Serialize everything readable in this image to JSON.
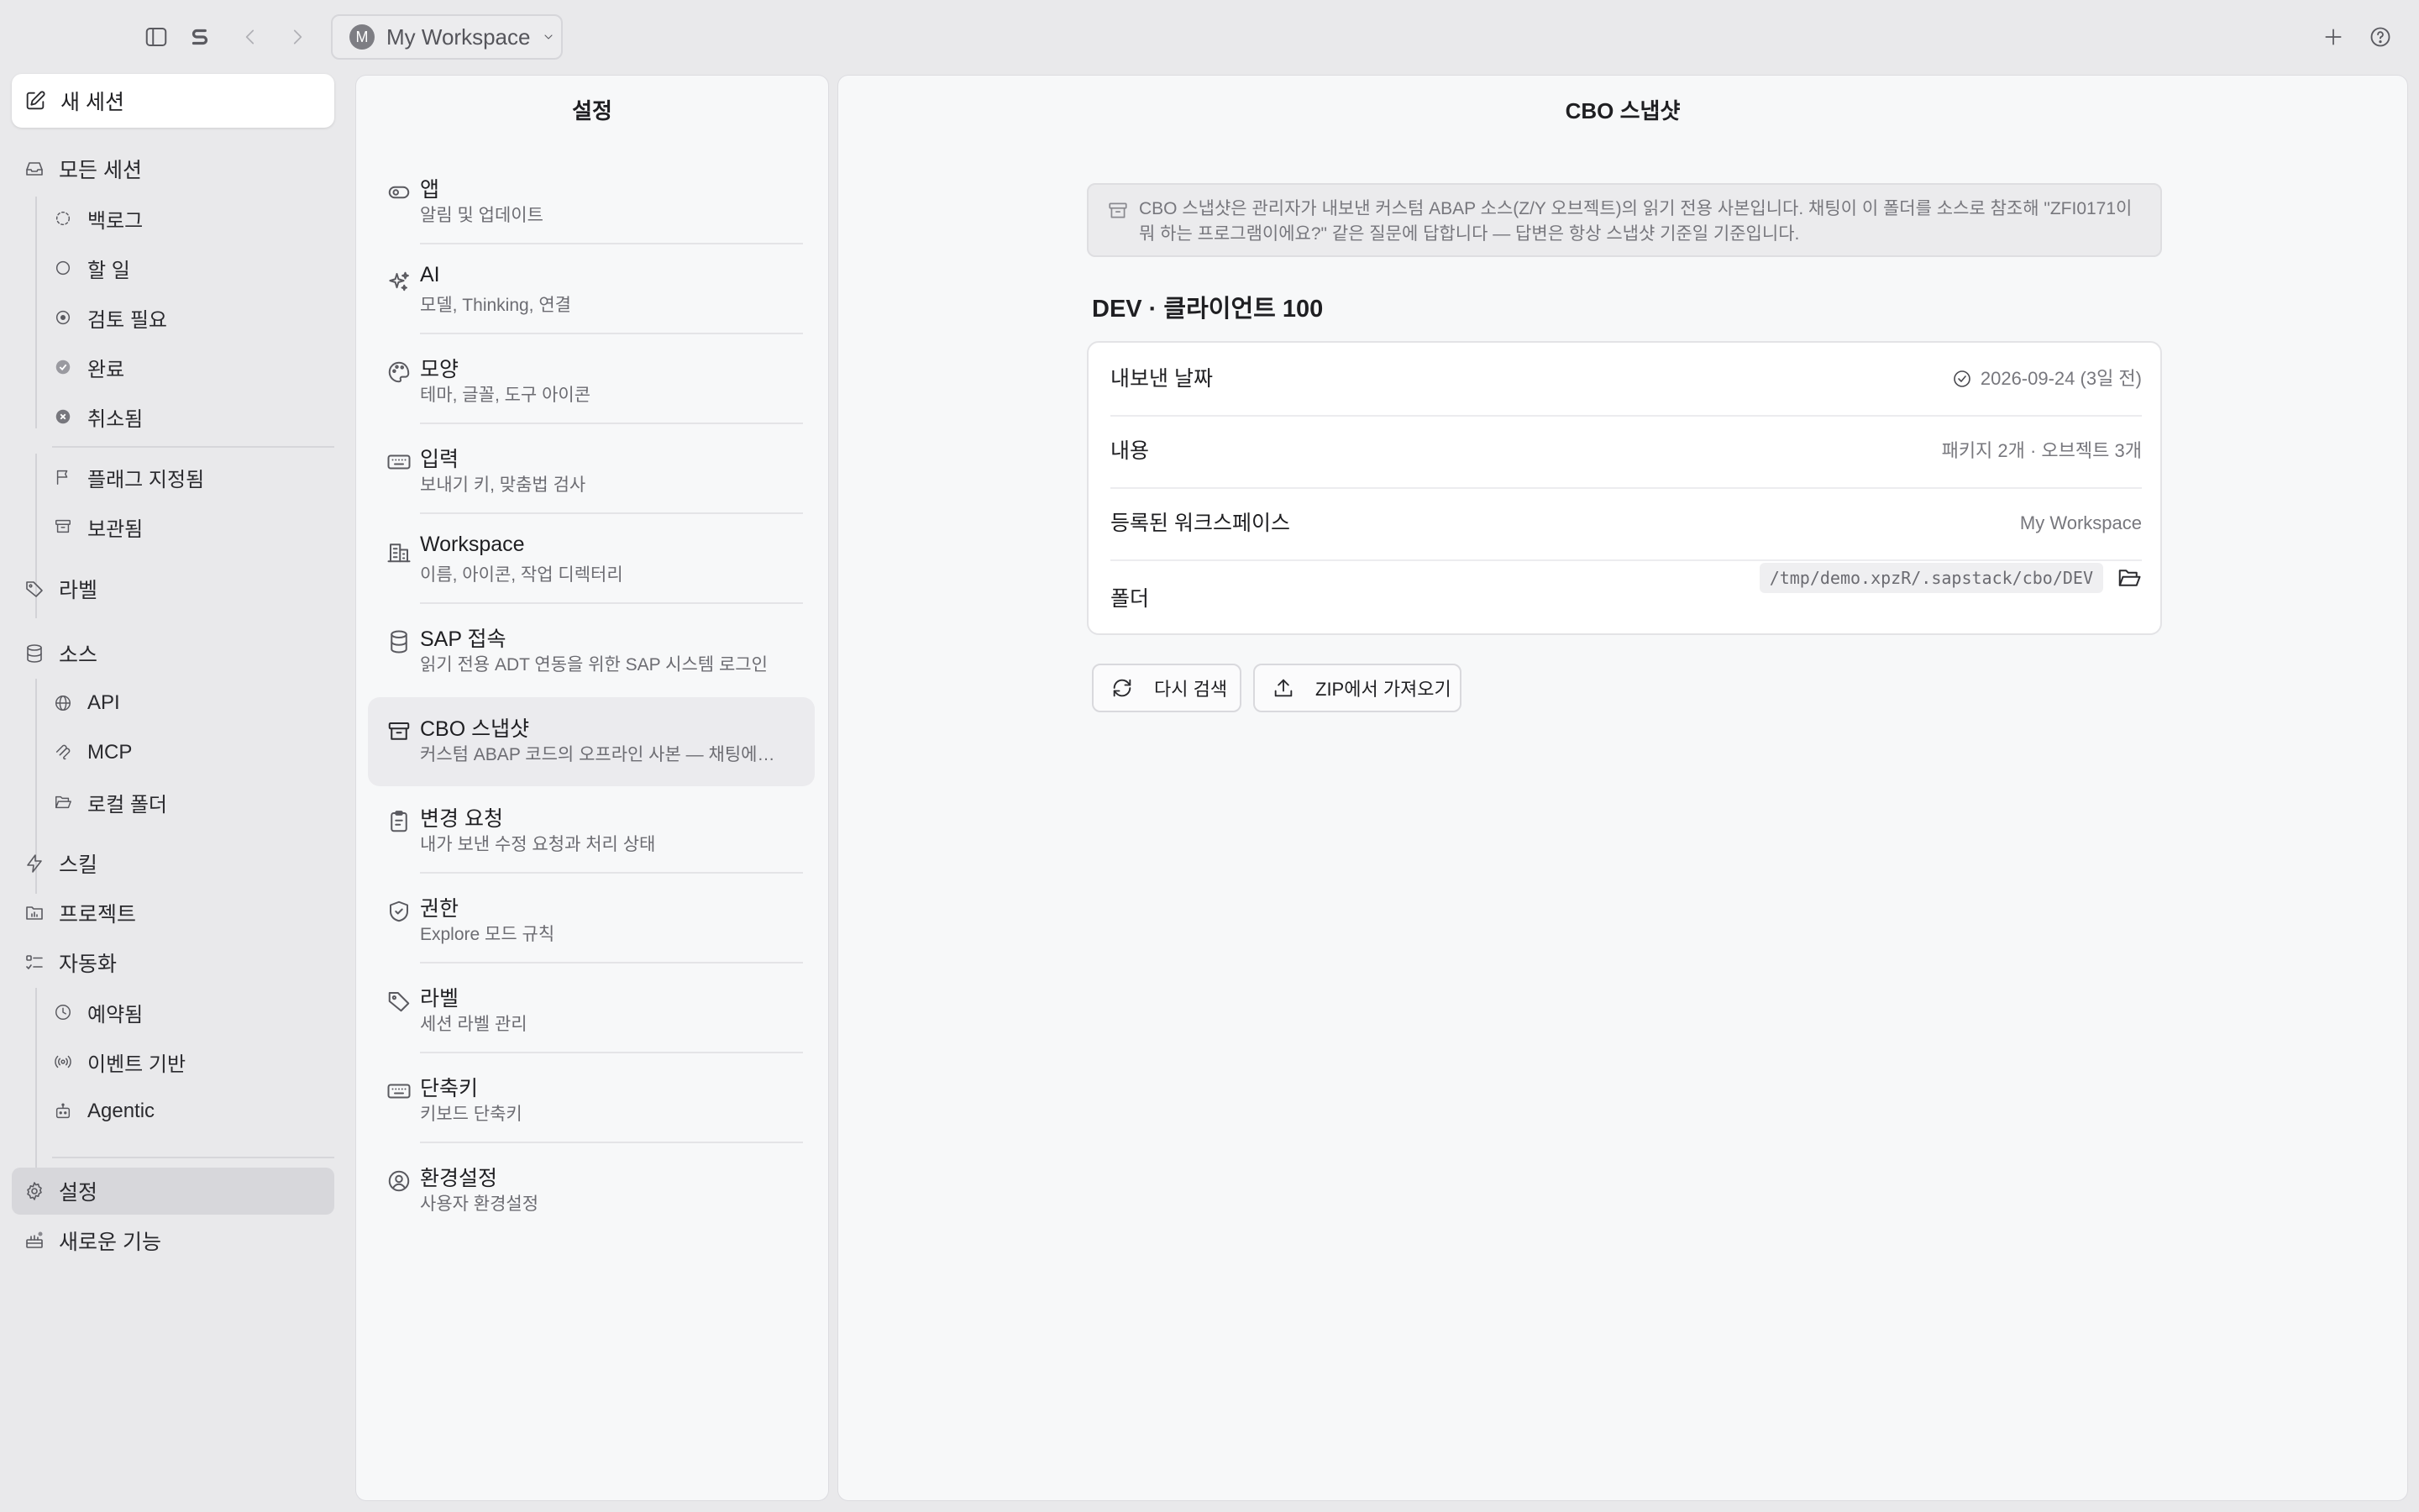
{
  "topbar": {
    "workspace_initial": "M",
    "workspace_name": "My Workspace"
  },
  "sidebar": {
    "new_session": "새 세션",
    "all_sessions": "모든 세션",
    "session_filters": {
      "backlog": "백로그",
      "todo": "할 일",
      "needs_review": "검토 필요",
      "done": "완료",
      "cancelled": "취소됨",
      "flagged": "플래그 지정됨",
      "archived": "보관됨"
    },
    "labels": "라벨",
    "sources": "소스",
    "source_items": {
      "api": "API",
      "mcp": "MCP",
      "local_folder": "로컬 폴더"
    },
    "skills": "스킬",
    "projects": "프로젝트",
    "automation": "자동화",
    "automation_items": {
      "scheduled": "예약됨",
      "event_based": "이벤트 기반",
      "agentic": "Agentic"
    },
    "settings": "설정",
    "whats_new": "새로운 기능"
  },
  "settings_panel": {
    "title": "설정",
    "items": [
      {
        "label": "앱",
        "desc": "알림 및 업데이트",
        "icon": "toggle-icon"
      },
      {
        "label": "AI",
        "desc": "모델, Thinking, 연결",
        "icon": "sparkles-icon"
      },
      {
        "label": "모양",
        "desc": "테마, 글꼴, 도구 아이콘",
        "icon": "palette-icon"
      },
      {
        "label": "입력",
        "desc": "보내기 키, 맞춤법 검사",
        "icon": "keyboard-icon"
      },
      {
        "label": "Workspace",
        "desc": "이름, 아이콘, 작업 디렉터리",
        "icon": "building-icon"
      },
      {
        "label": "SAP 접속",
        "desc": "읽기 전용 ADT 연동을 위한 SAP 시스템 로그인",
        "icon": "database-icon"
      },
      {
        "label": "CBO 스냅샷",
        "desc": "커스텀 ABAP 코드의 오프라인 사본 — 채팅에서 ...",
        "icon": "archive-icon"
      },
      {
        "label": "변경 요청",
        "desc": "내가 보낸 수정 요청과 처리 상태",
        "icon": "clipboard-icon"
      },
      {
        "label": "권한",
        "desc": "Explore 모드 규칙",
        "icon": "shield-icon"
      },
      {
        "label": "라벨",
        "desc": "세션 라벨 관리",
        "icon": "tag-icon"
      },
      {
        "label": "단축키",
        "desc": "키보드 단축키",
        "icon": "keyboard-icon"
      },
      {
        "label": "환경설정",
        "desc": "사용자 환경설정",
        "icon": "user-circle-icon"
      }
    ]
  },
  "main": {
    "title": "CBO 스냅샷",
    "info_text": "CBO 스냅샷은 관리자가 내보낸 커스텀 ABAP 소스(Z/Y 오브젝트)의 읽기 전용 사본입니다. 채팅이 이 폴더를 소스로 참조해 \"ZFI0171이 뭐 하는 프로그램이에요?\" 같은 질문에 답합니다 — 답변은 항상 스냅샷 기준일 기준입니다.",
    "env_heading": "DEV · 클라이언트 100",
    "rows": {
      "export_date_label": "내보낸 날짜",
      "export_date_value": "2026-09-24 (3일 전)",
      "contents_label": "내용",
      "contents_value": "패키지 2개 · 오브젝트 3개",
      "workspace_label": "등록된 워크스페이스",
      "workspace_value": "My Workspace",
      "folder_label": "폴더",
      "folder_value": "/tmp/demo.xpzR/.sapstack/cbo/DEV"
    },
    "rescan_button": "다시 검색",
    "import_zip_button": "ZIP에서 가져오기"
  }
}
